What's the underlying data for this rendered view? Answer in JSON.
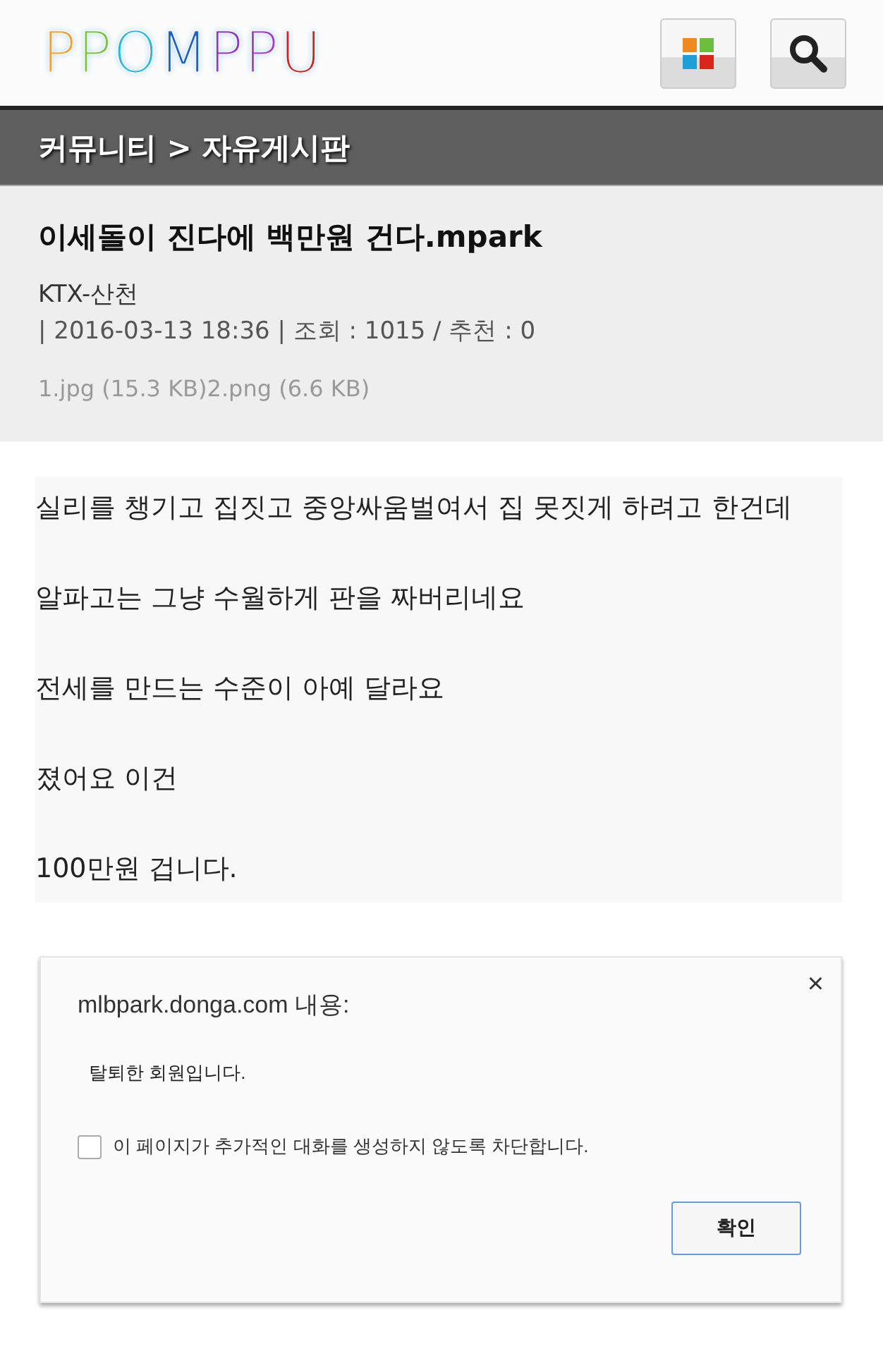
{
  "header": {
    "logo": [
      {
        "char": "P",
        "color": "#f0a030"
      },
      {
        "char": "P",
        "color": "#7cc040"
      },
      {
        "char": "O",
        "color": "#2bb5d8"
      },
      {
        "char": "M",
        "color": "#2060c0"
      },
      {
        "char": "P",
        "color": "#8a3cc0"
      },
      {
        "char": "P",
        "color": "#a040c8"
      },
      {
        "char": "U",
        "color": "#d02020"
      }
    ]
  },
  "breadcrumb": "커뮤니티 > 자유게시판",
  "post": {
    "title": "이세돌이 진다에 백만원 건다.mpark",
    "author": "KTX-산천",
    "meta": "| 2016-03-13 18:36 | 조회 : 1015 / 추천 : 0",
    "attachments": "1.jpg (15.3 KB)2.png (6.6 KB)",
    "lines": [
      "실리를 챙기고 집짓고 중앙싸움벌여서 집 못짓게 하려고 한건데",
      "알파고는 그냥 수월하게 판을 짜버리네요",
      "전세를 만드는 수준이 아예 달라요",
      "졌어요 이건",
      "100만원 겁니다."
    ]
  },
  "dialog": {
    "title": "mlbpark.donga.com 내용:",
    "close": "×",
    "message": "탈퇴한 회원입니다.",
    "checkbox": {
      "label": "이 페이지가 추가적인 대화를 생성하지 않도록 차단합니다.",
      "checked": false
    },
    "button": "확인"
  }
}
